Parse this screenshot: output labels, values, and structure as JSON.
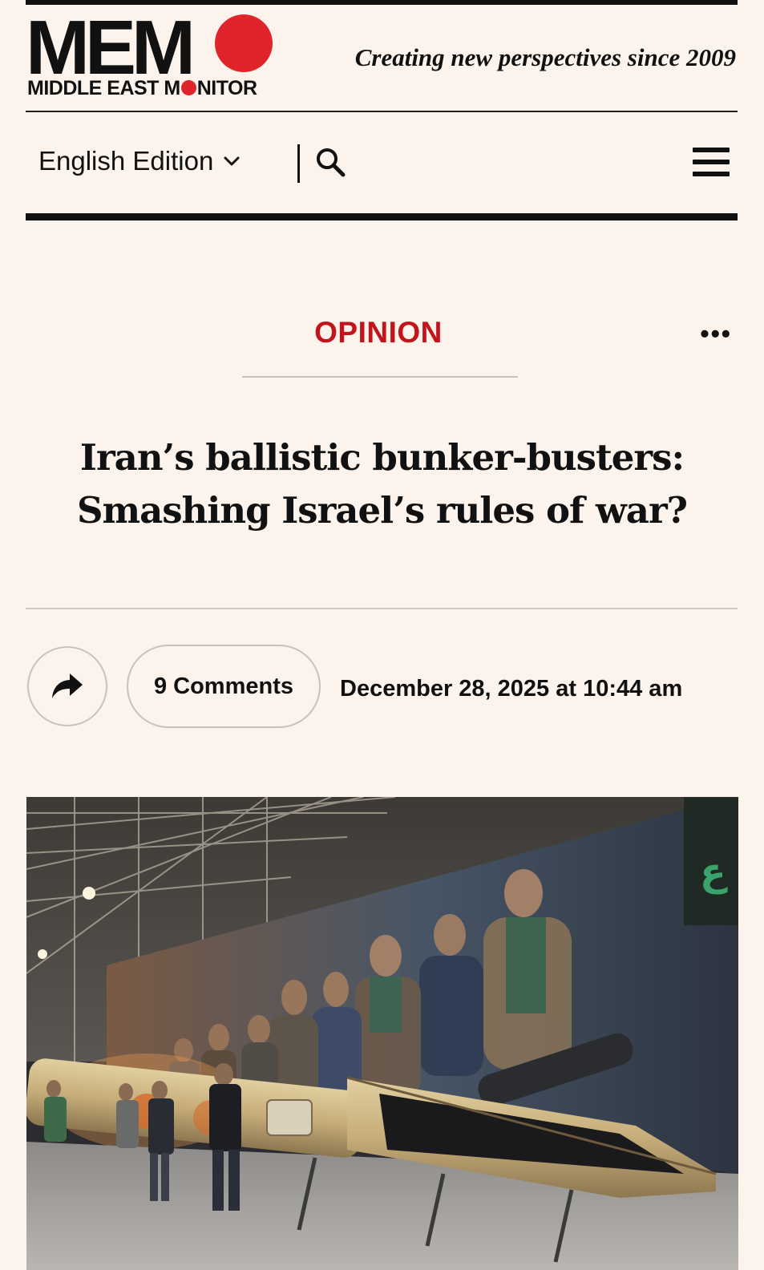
{
  "masthead": {
    "logo_text": "MEM",
    "logo_sub_before": "MIDDLE EAST M",
    "logo_sub_after": "NITOR",
    "tagline": "Creating new perspectives since 2009"
  },
  "nav": {
    "edition_label": "English Edition",
    "search_icon": "search-icon",
    "menu_icon": "hamburger-menu-icon"
  },
  "article": {
    "section": "OPINION",
    "more_icon": "more-options-icon",
    "headline_line1": "Iran’s ballistic bunker-busters:",
    "headline_line2": "Smashing Israel’s rules of war?",
    "share_icon": "share-arrow-icon",
    "comments_label": "9 Comments",
    "date": "December 28, 2025 at 10:44 am"
  },
  "colors": {
    "background": "#fbf3ec",
    "accent_red": "#e0242b",
    "section_red": "#c3141c"
  }
}
